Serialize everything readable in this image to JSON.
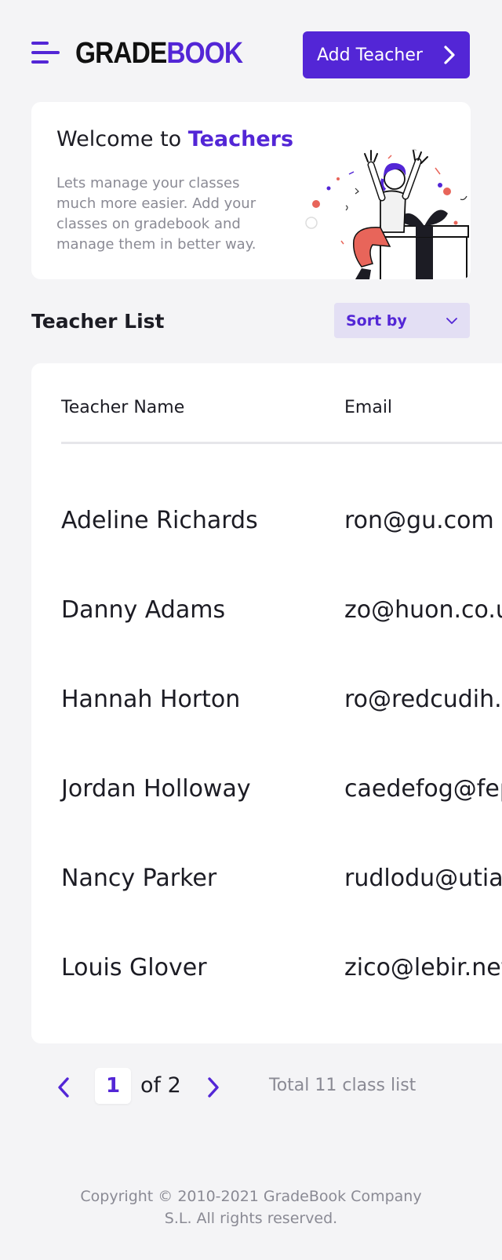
{
  "header": {
    "logo_part1": "GRADE",
    "logo_part2": "BOOK",
    "add_teacher_label": "Add Teacher",
    "accent_color": "#5326d6"
  },
  "welcome": {
    "title_prefix": "Welcome to ",
    "title_accent": "Teachers",
    "description": "Lets manage your classes much more easier. Add your classes on gradebook and manage them in better way."
  },
  "teacher_list": {
    "title": "Teacher List",
    "sort_label": "Sort by",
    "columns": [
      "Teacher Name",
      "Email"
    ],
    "rows": [
      {
        "name": "Adeline Richards",
        "email": "ron@gu.com"
      },
      {
        "name": "Danny Adams",
        "email": "zo@huon.co.uk"
      },
      {
        "name": "Hannah Horton",
        "email": "ro@redcudih.com"
      },
      {
        "name": "Jordan Holloway",
        "email": "caedefog@fep.com"
      },
      {
        "name": "Nancy Parker",
        "email": "rudlodu@utian.com"
      },
      {
        "name": "Louis Glover",
        "email": "zico@lebir.net"
      }
    ]
  },
  "pagination": {
    "current_page": "1",
    "of_label": "of 2",
    "total_label": "Total 11 class list"
  },
  "footer": {
    "copyright_line1": "Copyright © 2010-2021 GradeBook Company",
    "copyright_line2": "S.L. All rights reserved."
  },
  "icons": {
    "menu": "menu-icon",
    "add_teacher_chevron": "chevron-right-icon",
    "sort_chevron": "chevron-down-icon",
    "prev": "chevron-left-icon",
    "next": "chevron-right-icon"
  }
}
